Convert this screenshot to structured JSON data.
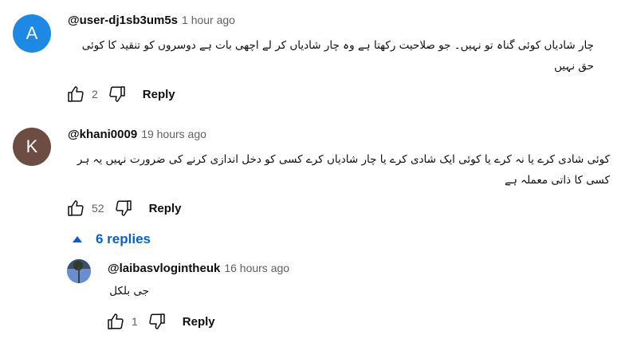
{
  "comments": [
    {
      "avatar_letter": "A",
      "author": "@user-dj1sb3um5s",
      "time": "1 hour ago",
      "text": "چار شادیاں کوئی گناہ تو نہیں۔ جو صلاحیت رکھتا ہے وہ چار شادیاں کر لے اچھی بات ہے دوسروں کو تنقید کا کوئی حق نہیں",
      "likes": "2",
      "reply_label": "Reply"
    },
    {
      "avatar_letter": "K",
      "author": "@khani0009",
      "time": "19 hours ago",
      "text": "کوئی شادی کرے یا نہ کرے یا کوئی ایک شادی کرے یا چار شادیاں کرے کسی کو دخل اندازی کرنے کی ضرورت نہیں یہ ہر کسی کا ذاتی معملہ ہے",
      "likes": "52",
      "reply_label": "Reply",
      "replies_toggle": "6 replies"
    }
  ],
  "reply": {
    "author": "@laibasvlogintheuk",
    "time": "16 hours ago",
    "text": "جی بلکل",
    "likes": "1",
    "reply_label": "Reply"
  },
  "colors": {
    "avatar_a": "#1e88e5",
    "avatar_k": "#6d4c41",
    "link_blue": "#065fd4",
    "secondary_text": "#606060"
  }
}
